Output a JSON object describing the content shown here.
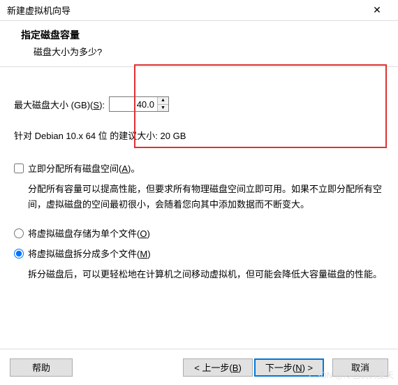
{
  "window": {
    "title": "新建虚拟机向导"
  },
  "header": {
    "title": "指定磁盘容量",
    "subtitle": "磁盘大小为多少?"
  },
  "disk": {
    "label_prefix": "最大磁盘大小 (GB)(",
    "label_key": "S",
    "label_suffix": "):",
    "value": "40.0",
    "recommend": "针对 Debian 10.x 64 位 的建议大小: 20 GB"
  },
  "allocate": {
    "label_pre": "立即分配所有磁盘空间(",
    "key": "A",
    "label_post": ")。",
    "desc": "分配所有容量可以提高性能，但要求所有物理磁盘空间立即可用。如果不立即分配所有空间，虚拟磁盘的空间最初很小，会随着您向其中添加数据而不断变大。"
  },
  "split": {
    "single_pre": "将虚拟磁盘存储为单个文件(",
    "single_key": "O",
    "single_post": ")",
    "multi_pre": "将虚拟磁盘拆分成多个文件(",
    "multi_key": "M",
    "multi_post": ")",
    "desc": "拆分磁盘后，可以更轻松地在计算机之间移动虚拟机，但可能会降低大容量磁盘的性能。"
  },
  "footer": {
    "help": "帮助",
    "back_pre": "< 上一步(",
    "back_key": "B",
    "back_post": ")",
    "next_pre": "下一步(",
    "next_key": "N",
    "next_post": ") >",
    "cancel": "取消"
  },
  "watermark": "CSDN @冷色调的夏天"
}
